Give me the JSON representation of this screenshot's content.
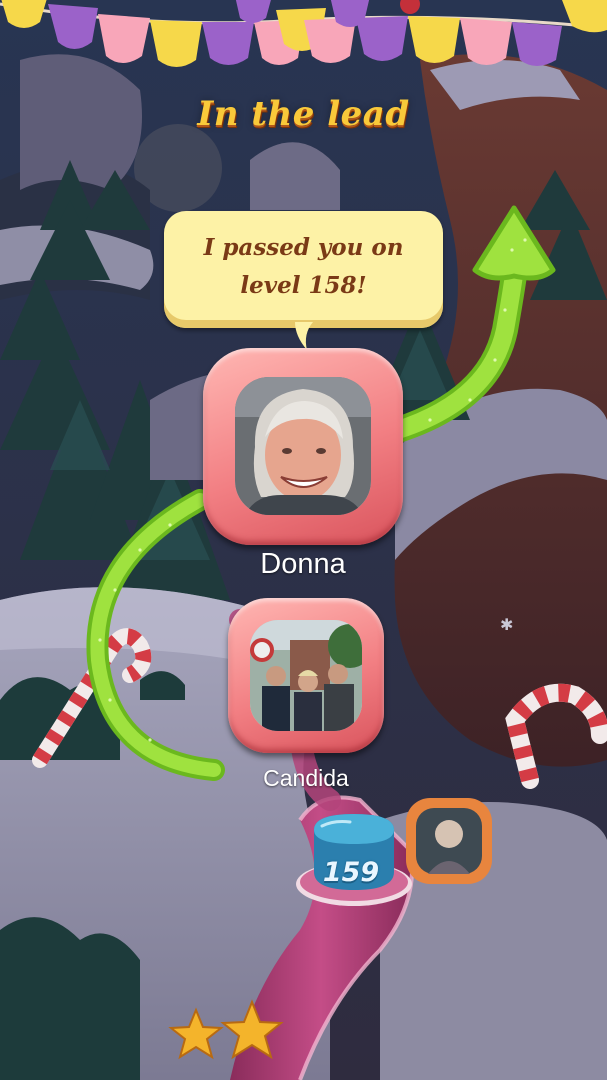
{
  "screen": {
    "heading": "In the lead",
    "speech_bubble": {
      "text": "I passed you on level 158!"
    }
  },
  "players": {
    "leader": {
      "name": "Donna"
    },
    "passed": {
      "name": "Candida"
    }
  },
  "map": {
    "current_level": "159",
    "stars_earned": 2
  },
  "colors": {
    "heading": "#f9c93a",
    "bubble": "#fdf2a6",
    "bubble_text": "#7a3a16",
    "frame": "#f27f83",
    "arrow": "#8fd93a",
    "level_badge": "#2f8fbf"
  },
  "icons": [
    "bunting-flags",
    "green-arrow-icon",
    "star-icon",
    "candy-cane",
    "level-node"
  ]
}
